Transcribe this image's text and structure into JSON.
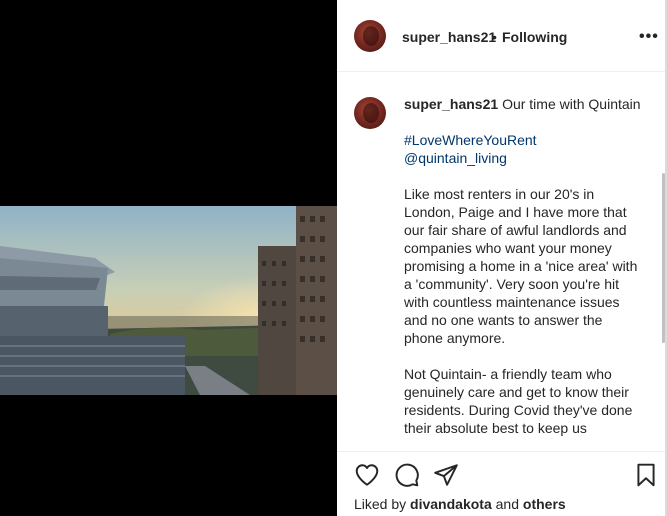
{
  "post": {
    "username": "super_hans21",
    "separator": "•",
    "follow_status": "Following",
    "more_label": "•••"
  },
  "caption": {
    "username": "super_hans21",
    "title": "Our time with Quintain",
    "hashtag": "#LoveWhereYouRent",
    "mention": "@quintain_living",
    "paragraph1": "Like most renters in our 20's in London, Paige and I have more that our fair share of awful landlords and companies who want your money promising a home in a 'nice area' with a 'community'. Very soon you're hit with countless maintenance issues and no one wants to answer the phone anymore.",
    "paragraph2": "Not Quintain- a friendly team who genuinely care and get to know their residents. During Covid they've done their absolute best to keep us"
  },
  "likes": {
    "prefix": "Liked by",
    "user": "divandakota",
    "joiner": "and",
    "others": "others"
  },
  "icons": {
    "like": "heart-icon",
    "comment": "comment-icon",
    "share": "share-icon",
    "save": "bookmark-icon"
  }
}
